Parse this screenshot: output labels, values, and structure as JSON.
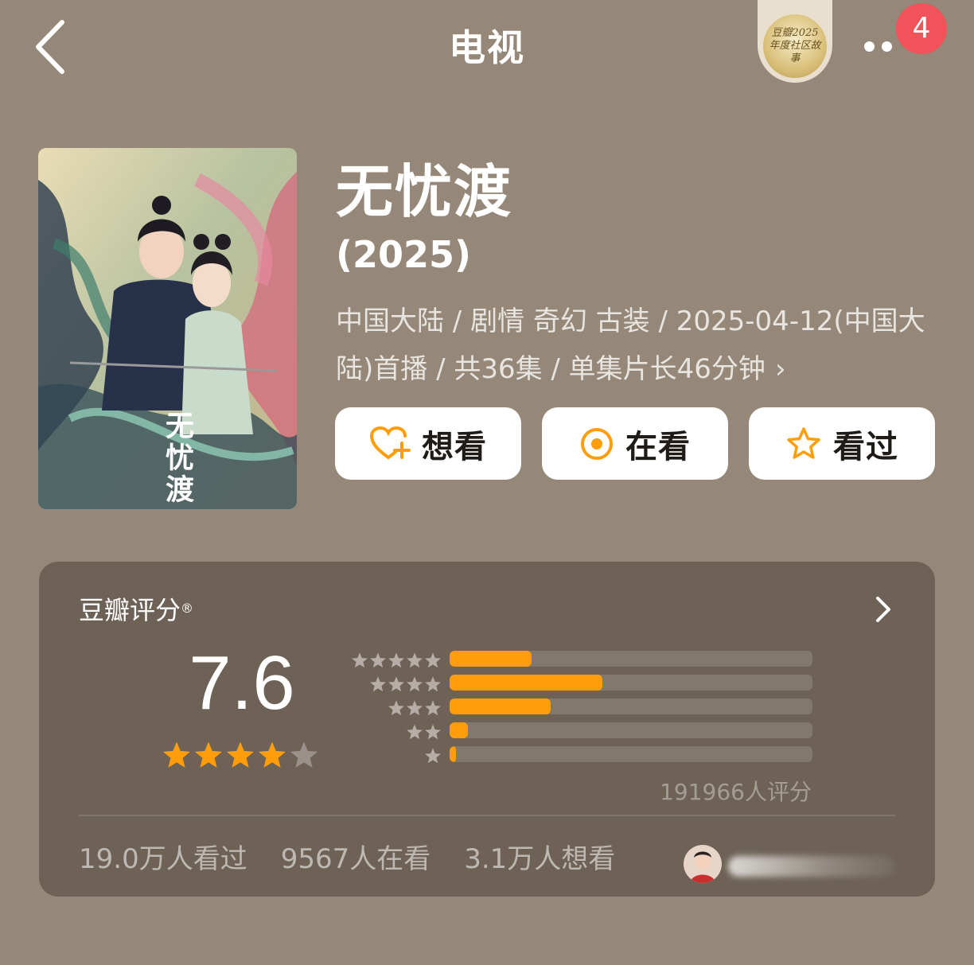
{
  "header": {
    "title": "电视",
    "badge_text": "豆瓣2025 年度社区故事",
    "notification_count": "4",
    "icons": [
      "chevron-left-icon",
      "more-dots-icon"
    ]
  },
  "movie": {
    "title": "无忧渡",
    "year": "(2025)",
    "meta": "中国大陆 / 剧情 奇幻 古装 / 2025-04-12(中国大陆)首播 / 共36集 / 单集片长46分钟",
    "meta_arrow": "›",
    "poster_text": "无忧渡"
  },
  "actions": [
    {
      "label": "想看",
      "icon": "heart-plus-icon"
    },
    {
      "label": "在看",
      "icon": "target-circle-icon"
    },
    {
      "label": "看过",
      "icon": "star-outline-icon"
    }
  ],
  "rating": {
    "title": "豆瓣评分",
    "registered_mark": "®",
    "score": "7.6",
    "stars_filled": 4,
    "stars_total": 5,
    "distribution": [
      {
        "stars": 5,
        "fraction": 0.225
      },
      {
        "stars": 4,
        "fraction": 0.42
      },
      {
        "stars": 3,
        "fraction": 0.278
      },
      {
        "stars": 2,
        "fraction": 0.05
      },
      {
        "stars": 1,
        "fraction": 0.018
      }
    ],
    "count_text": "191966人评分",
    "stats": [
      "19.0万人看过",
      "9567人在看",
      "3.1万人想看"
    ]
  },
  "colors": {
    "background": "#958878",
    "card": "#6d6255",
    "accent": "#ff9d0a",
    "badge": "#f2525a"
  }
}
